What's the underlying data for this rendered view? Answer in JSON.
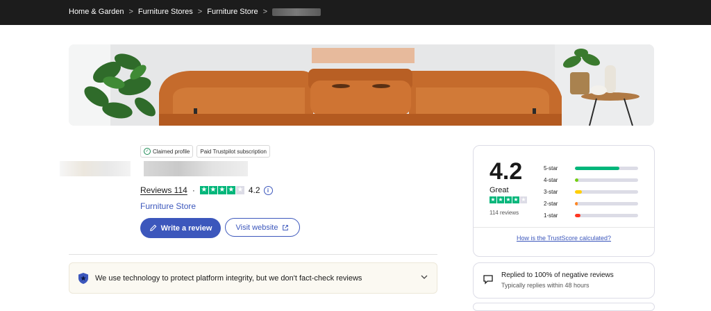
{
  "breadcrumb": {
    "items": [
      "Home & Garden",
      "Furniture Stores",
      "Furniture Store"
    ],
    "separator": ">"
  },
  "badges": {
    "claimed": "Claimed profile",
    "paid": "Paid Trustpilot subscription"
  },
  "business": {
    "reviews_label": "Reviews 114",
    "dot": "·",
    "score": "4.2",
    "stars_filled": 4,
    "stars_total": 5,
    "category": "Furniture Store"
  },
  "actions": {
    "write_review": "Write a review",
    "visit_website": "Visit website"
  },
  "notice": {
    "text": "We use technology to protect platform integrity, but we don't fact-check reviews"
  },
  "trustscore": {
    "score": "4.2",
    "label": "Great",
    "count": "114 reviews",
    "distribution": [
      {
        "label": "5-star",
        "fraction": 0.7,
        "color": "#00b67a"
      },
      {
        "label": "4-star",
        "fraction": 0.06,
        "color": "#73cf11"
      },
      {
        "label": "3-star",
        "fraction": 0.11,
        "color": "#ffce00"
      },
      {
        "label": "2-star",
        "fraction": 0.02,
        "color": "#ff8622"
      },
      {
        "label": "1-star",
        "fraction": 0.09,
        "color": "#ff3722"
      }
    ],
    "calc_link": "How is the TrustScore calculated?"
  },
  "reply": {
    "title": "Replied to 100% of negative reviews",
    "sub": "Typically replies within 48 hours"
  },
  "colors": {
    "accent": "#3c57bc",
    "star_green": "#00b67a",
    "topbar": "#1c1c1c"
  }
}
